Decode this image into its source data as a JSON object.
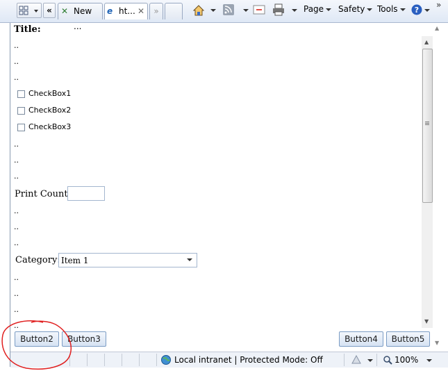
{
  "toolbar": {
    "tabs": [
      {
        "label": "New ...",
        "icon": "new-tab-icon"
      },
      {
        "label": "ht...",
        "icon": "ie-page-icon"
      }
    ],
    "commands": {
      "page": "Page",
      "safety": "Safety",
      "tools": "Tools"
    },
    "more": "»"
  },
  "page": {
    "title": "Title:",
    "dots": "..",
    "checkboxes": [
      "CheckBox1",
      "CheckBox2",
      "CheckBox3"
    ],
    "print_count_label": "Print Count:",
    "print_count_value": "",
    "category_label": "Category:",
    "category_value": "Item 1",
    "buttons": [
      "Button2",
      "Button3",
      "Button4",
      "Button5"
    ]
  },
  "statusbar": {
    "zone": "Local intranet | Protected Mode: Off",
    "zoom": "100%"
  },
  "colors": {
    "annotation": "#e02020",
    "button_border": "#7b9cc4"
  }
}
